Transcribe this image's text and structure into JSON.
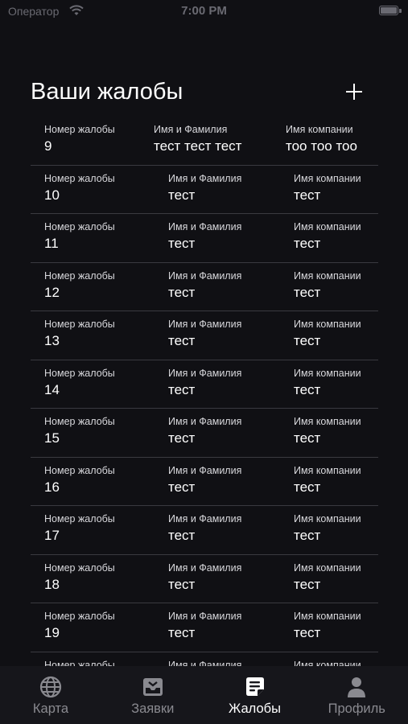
{
  "status_bar": {
    "carrier": "Оператор",
    "time": "7:00 PM"
  },
  "header": {
    "title": "Ваши жалобы"
  },
  "columns": {
    "number": "Номер жалобы",
    "name": "Имя и Фамилия",
    "company": "Имя компании"
  },
  "complaints": [
    {
      "number": "9",
      "name": "тест тест тест",
      "company": "тоо тоо тоо"
    },
    {
      "number": "10",
      "name": "тест",
      "company": "тест"
    },
    {
      "number": "11",
      "name": "тест",
      "company": "тест"
    },
    {
      "number": "12",
      "name": "тест",
      "company": "тест"
    },
    {
      "number": "13",
      "name": "тест",
      "company": "тест"
    },
    {
      "number": "14",
      "name": "тест",
      "company": "тест"
    },
    {
      "number": "15",
      "name": "тест",
      "company": "тест"
    },
    {
      "number": "16",
      "name": "тест",
      "company": "тест"
    },
    {
      "number": "17",
      "name": "тест",
      "company": "тест"
    },
    {
      "number": "18",
      "name": "тест",
      "company": "тест"
    },
    {
      "number": "19",
      "name": "тест",
      "company": "тест"
    },
    {
      "number": "",
      "name": "",
      "company": ""
    }
  ],
  "tabs": [
    {
      "label": "Карта",
      "icon": "globe-icon",
      "active": false
    },
    {
      "label": "Заявки",
      "icon": "inbox-icon",
      "active": false
    },
    {
      "label": "Жалобы",
      "icon": "note-icon",
      "active": true
    },
    {
      "label": "Профиль",
      "icon": "person-icon",
      "active": false
    }
  ],
  "colors": {
    "background": "#101014",
    "tabbar": "#16161b",
    "divider": "#3a3a40",
    "inactive": "#8a8a90",
    "active": "#ffffff"
  }
}
